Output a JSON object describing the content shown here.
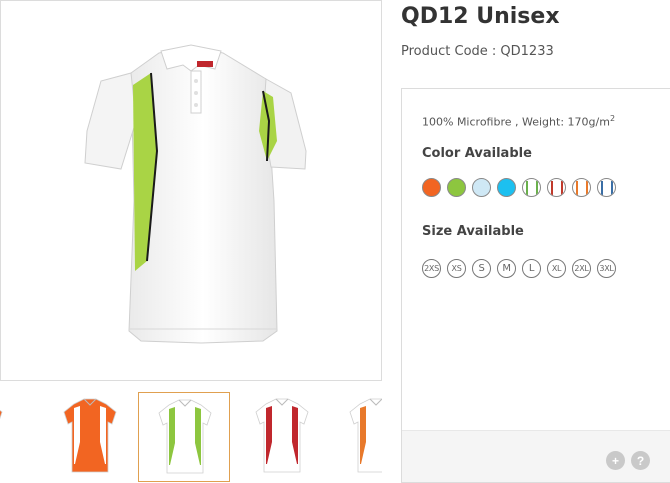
{
  "product": {
    "title": "QD12 Unisex",
    "code_text": "Product Code : QD1233"
  },
  "specs": {
    "line": "100% Microfibre , Weight: 170g/m",
    "superscript": "2"
  },
  "colors": {
    "heading": "Color Available",
    "swatches": [
      {
        "name": "orange",
        "fill": "#f26522"
      },
      {
        "name": "lime-green",
        "fill": "#8dc63f"
      },
      {
        "name": "light-blue",
        "fill": "#cfe8f5"
      },
      {
        "name": "sky-blue",
        "fill": "#1cc0f0"
      },
      {
        "name": "white-with-green",
        "fill": "#ffffff",
        "stripe": "#6ab04c"
      },
      {
        "name": "white-with-red",
        "fill": "#ffffff",
        "stripe": "#c0392b"
      },
      {
        "name": "white-with-orange",
        "fill": "#ffffff",
        "stripe": "#e8792b"
      },
      {
        "name": "white-with-blue",
        "fill": "#ffffff",
        "stripe": "#3a6ea5"
      }
    ]
  },
  "sizes": {
    "heading": "Size Available",
    "options": [
      "2XS",
      "XS",
      "S",
      "M",
      "L",
      "XL",
      "2XL",
      "3XL"
    ]
  },
  "footer": {
    "plus_label": "+",
    "help_label": "?"
  },
  "thumbnails": [
    {
      "name": "orange",
      "body": "#f26522",
      "accent": "#ffffff"
    },
    {
      "name": "orange-back",
      "body": "#f26522",
      "accent": "#ffffff"
    },
    {
      "name": "white-lime",
      "body": "#ffffff",
      "accent": "#8dc63f",
      "selected": true
    },
    {
      "name": "white-red",
      "body": "#ffffff",
      "accent": "#c0272d"
    },
    {
      "name": "white-orange",
      "body": "#ffffff",
      "accent": "#e8792b"
    }
  ]
}
